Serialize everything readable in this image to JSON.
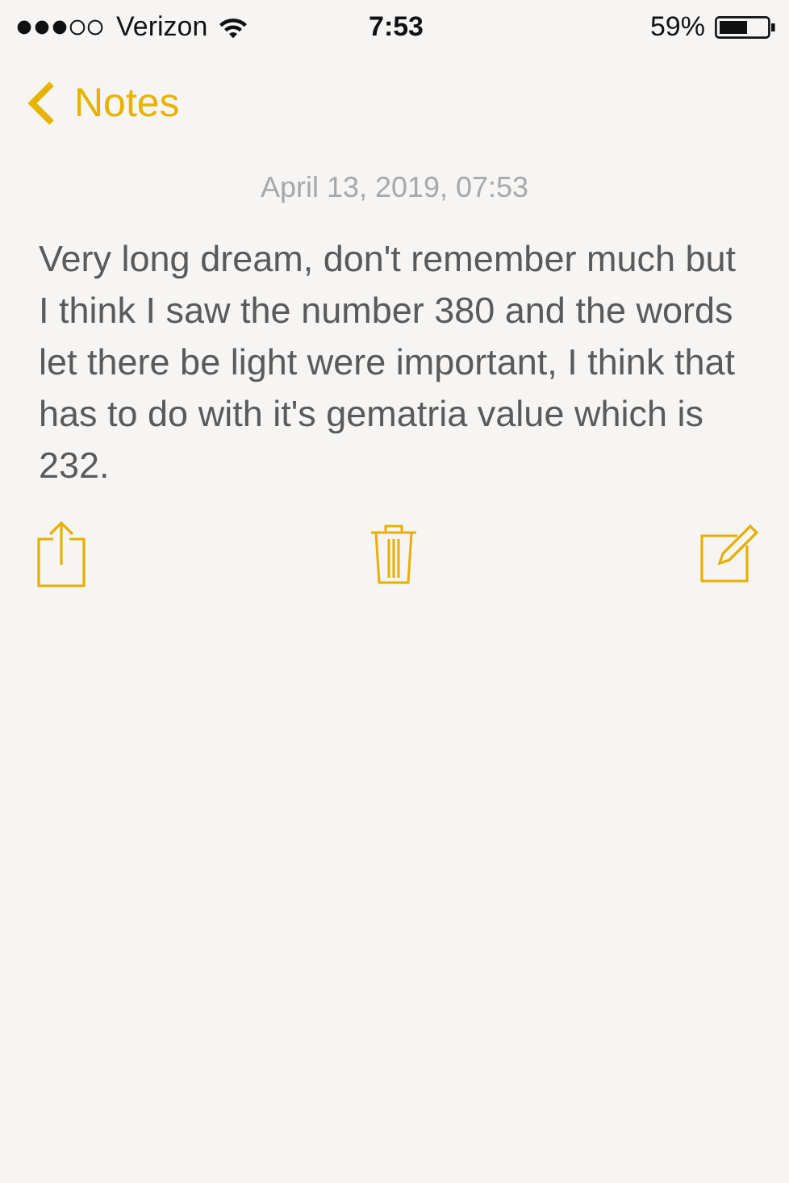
{
  "status_bar": {
    "carrier": "Verizon",
    "time": "7:53",
    "battery": "59%"
  },
  "nav_bar": {
    "back_label": "Notes"
  },
  "note": {
    "date": "April 13, 2019, 07:53",
    "text": "Very long dream, don't remember much but I think I saw the number 380 and the words let there be light were important, I think that has to do with it's gematria value which is 232."
  }
}
